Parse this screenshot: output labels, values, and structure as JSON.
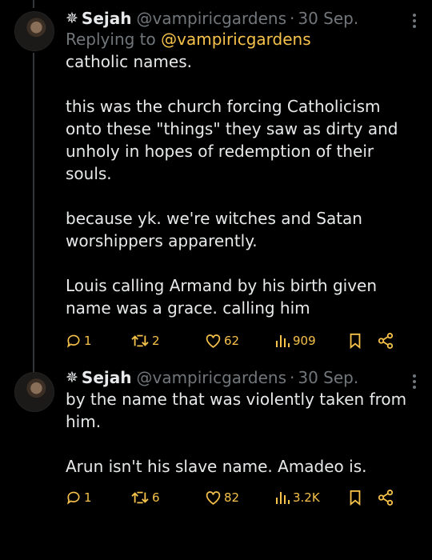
{
  "tweets": [
    {
      "display_name": "Sejah",
      "handle": "@vampiricgardens",
      "separator": "·",
      "date": "30 Sep.",
      "replying_prefix": "Replying to",
      "replying_to": "@vampiricgardens",
      "paragraphs": [
        "catholic names.",
        "this was the church forcing Catholicism onto these \"things\" they saw as dirty and unholy in hopes of redemption of their souls.",
        "because yk. we're witches and Satan worshippers apparently.",
        "Louis calling Armand by his birth given name was a grace. calling him"
      ],
      "replies": "1",
      "retweets": "2",
      "likes": "62",
      "views": "909"
    },
    {
      "display_name": "Sejah",
      "handle": "@vampiricgardens",
      "separator": "·",
      "date": "30 Sep.",
      "paragraphs": [
        "by the name that was violently taken from him.",
        "Arun isn't his slave name. Amadeo is."
      ],
      "replies": "1",
      "retweets": "6",
      "likes": "82",
      "views": "3.2K"
    }
  ],
  "colors": {
    "accent": "#f6c24a",
    "text": "#e7e9ea",
    "muted": "#71767b",
    "background": "#000000"
  },
  "icons": [
    "sparkle-icon",
    "more-icon",
    "reply-icon",
    "retweet-icon",
    "like-icon",
    "views-icon",
    "bookmark-icon",
    "share-icon"
  ]
}
